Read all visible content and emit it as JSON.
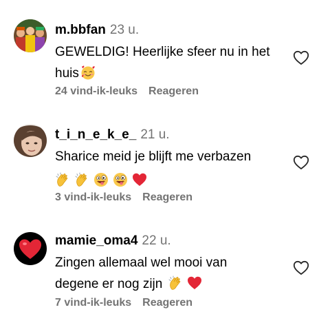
{
  "comments": [
    {
      "username": "m.bbfan",
      "age": "23 u.",
      "text_line1": "GEWELDIG! Heerlijke sfeer nu in het",
      "text_line2": "huis",
      "likes": "24 vind-ik-leuks",
      "reply_label": "Reageren",
      "emojis": [
        "smiling-face-with-hearts-emoji"
      ]
    },
    {
      "username": "t_i_n_e_k_e_",
      "age": "21 u.",
      "text_line1": "Sharice meid je blijft me verbazen",
      "likes": "3 vind-ik-leuks",
      "reply_label": "Reageren",
      "emojis": [
        "clapping-hands-emoji",
        "clapping-hands-emoji",
        "zany-face-emoji",
        "zany-face-emoji",
        "red-heart-emoji"
      ]
    },
    {
      "username": "mamie_oma4",
      "age": "22 u.",
      "text_line1": "Zingen allemaal wel mooi van",
      "text_line2": "degene er nog zijn",
      "likes": "7 vind-ik-leuks",
      "reply_label": "Reageren",
      "emojis": [
        "clapping-hands-emoji",
        "red-heart-emoji"
      ]
    }
  ],
  "icons": {
    "like": "heart-outline-icon"
  },
  "colors": {
    "secondary_text": "#737373",
    "heart_red": "#e0245e",
    "clap_yellow": "#f7c23a"
  }
}
